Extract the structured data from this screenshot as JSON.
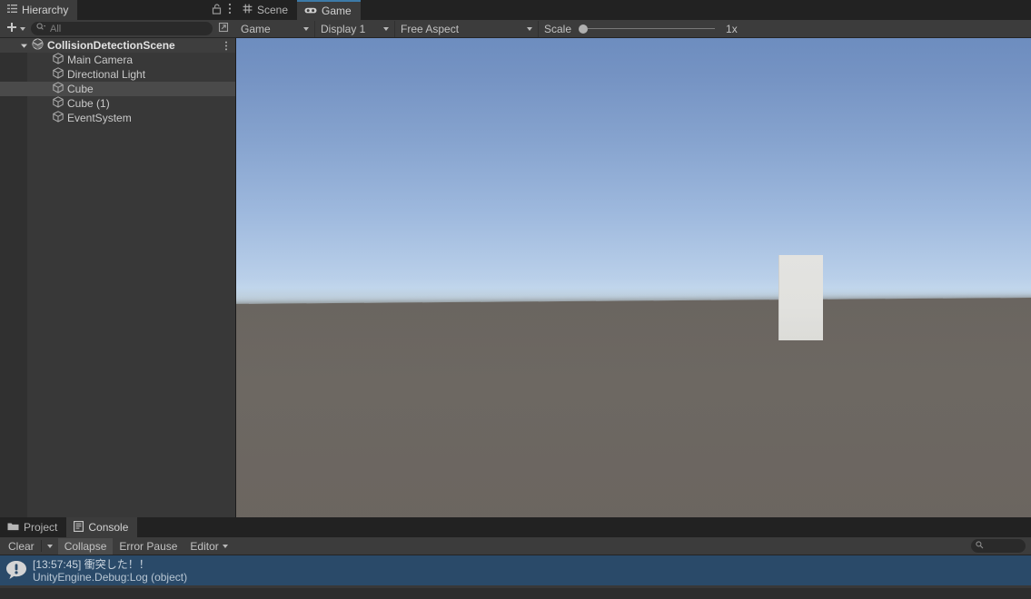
{
  "hierarchy": {
    "tab_label": "Hierarchy",
    "tab_icon": "hierarchy-icon",
    "lock_icon": "lock-open-icon",
    "menu_icon": "kebab-menu-icon",
    "add_label": "+",
    "search_placeholder": "All",
    "search_icon": "search-dropdown-icon",
    "popout_icon": "open-in-new-window-icon",
    "scene": {
      "name": "CollisionDetectionScene",
      "icon": "unity-scene-icon",
      "expanded": true,
      "menu_icon": "kebab-menu-icon"
    },
    "objects": [
      {
        "name": "Main Camera",
        "icon": "gameobject-cube-icon",
        "selected": false
      },
      {
        "name": "Directional Light",
        "icon": "gameobject-cube-icon",
        "selected": false
      },
      {
        "name": "Cube",
        "icon": "gameobject-cube-icon",
        "selected": true
      },
      {
        "name": "Cube (1)",
        "icon": "gameobject-cube-icon",
        "selected": false
      },
      {
        "name": "EventSystem",
        "icon": "gameobject-cube-icon",
        "selected": false
      }
    ]
  },
  "game_panel": {
    "tabs": [
      {
        "label": "Scene",
        "icon": "scene-grid-icon",
        "active": false
      },
      {
        "label": "Game",
        "icon": "gamepad-icon",
        "active": true
      }
    ],
    "toolbar": {
      "play_mode": "Game",
      "display": "Display 1",
      "aspect": "Free Aspect",
      "scale_label": "Scale",
      "scale_value": "1x"
    }
  },
  "console": {
    "tabs": [
      {
        "label": "Project",
        "icon": "folder-icon",
        "active": false
      },
      {
        "label": "Console",
        "icon": "console-icon",
        "active": true
      }
    ],
    "toolbar": {
      "clear_label": "Clear",
      "clear_dropdown_icon": "chevron-down-icon",
      "collapse_label": "Collapse",
      "error_pause_label": "Error Pause",
      "editor_label": "Editor",
      "editor_dropdown_icon": "chevron-down-icon",
      "search_icon": "search-icon"
    },
    "entries": [
      {
        "icon": "info-log-icon",
        "line1": "[13:57:45] 衝突した！！",
        "line2": "UnityEngine.Debug:Log (object)",
        "selected": true
      }
    ]
  },
  "colors": {
    "panel_bg": "#383838",
    "toolbar_bg": "#3c3c3c",
    "tabbar_bg": "#222222",
    "accent_tab": "#3d7ba8",
    "selection_blue": "#2a4a69",
    "selection_gray": "#4a4a4a"
  }
}
